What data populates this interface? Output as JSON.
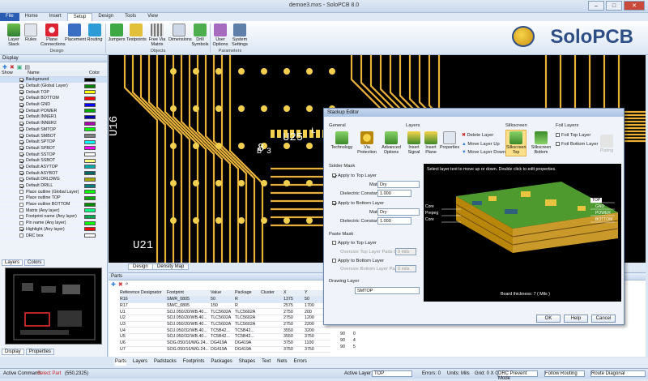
{
  "window": {
    "title": "demoe3.mxs - SoloPCB 8.0"
  },
  "tabs": [
    "File",
    "Home",
    "Insert",
    "Setup",
    "Design",
    "Tools",
    "View"
  ],
  "ribbon": {
    "buttons": [
      "Layer Stack",
      "Rules",
      "Plane Connections",
      "Placement",
      "Routing",
      "Jumpers",
      "Testpoints",
      "Free Via Matrix",
      "Dimensions",
      "Drill Symbols",
      "User Options",
      "System Settings"
    ],
    "groups": [
      "Design",
      "Objects",
      "Parameters"
    ]
  },
  "logo": "SoloPCB",
  "display_panel": {
    "title": "Display",
    "columns": [
      "Show",
      "Name",
      "Color"
    ],
    "layers": [
      {
        "name": "Background",
        "on": true,
        "color": "#000000"
      },
      {
        "name": "Default (Global Layer)",
        "on": true,
        "color": "#008000"
      },
      {
        "name": "Default TOP",
        "on": true,
        "color": "#ffff00"
      },
      {
        "name": "Default BOTTOM",
        "on": true,
        "color": "#ff0000"
      },
      {
        "name": "Default GND",
        "on": true,
        "color": "#0000ff"
      },
      {
        "name": "Default POWER",
        "on": true,
        "color": "#00aa00"
      },
      {
        "name": "Default INNER1",
        "on": true,
        "color": "#0000aa"
      },
      {
        "name": "Default INNER2",
        "on": true,
        "color": "#aa00aa"
      },
      {
        "name": "Default SMTOP",
        "on": true,
        "color": "#00ff00"
      },
      {
        "name": "Default SMBOT",
        "on": true,
        "color": "#808080"
      },
      {
        "name": "Default SPTOP",
        "on": true,
        "color": "#00ffff"
      },
      {
        "name": "Default SPBOT",
        "on": true,
        "color": "#ff00ff"
      },
      {
        "name": "Default SSTOP",
        "on": true,
        "color": "#ffffff"
      },
      {
        "name": "Default SSBOT",
        "on": true,
        "color": "#ffff80"
      },
      {
        "name": "Default ASYTOP",
        "on": true,
        "color": "#00aaaa"
      },
      {
        "name": "Default ASYBOT",
        "on": true,
        "color": "#006666"
      },
      {
        "name": "Default DRLDWG",
        "on": true,
        "color": "#aaaa00"
      },
      {
        "name": "Default DRILL",
        "on": true,
        "color": "#008080"
      },
      {
        "name": "Place outline (Global Layer)",
        "on": false,
        "color": "#00ff00"
      },
      {
        "name": "Place outline TOP",
        "on": false,
        "color": "#00aa00"
      },
      {
        "name": "Place outline BOTTOM",
        "on": false,
        "color": "#008800"
      },
      {
        "name": "Matrix (Any layer)",
        "on": false,
        "color": "#00ff80"
      },
      {
        "name": "Footprint name (Any layer)",
        "on": false,
        "color": "#00aa55"
      },
      {
        "name": "Pin name (Any layer)",
        "on": false,
        "color": "#00ff00"
      },
      {
        "name": "Highlight (Any layer)",
        "on": true,
        "color": "#ff0000"
      },
      {
        "name": "DRC box",
        "on": false,
        "color": "#ffffff"
      }
    ],
    "subtabs": [
      "Layers",
      "Colors"
    ]
  },
  "overview_tabs": [
    "Display",
    "Properties"
  ],
  "canvas": {
    "labels": [
      "U16",
      "U25",
      "U21",
      "8",
      "B",
      "3",
      "L",
      "F"
    ],
    "tabs": [
      "Design",
      "Density Map"
    ]
  },
  "parts": {
    "title": "Parts",
    "columns": [
      "Reference Designator",
      "Footprint",
      "Value",
      "Package",
      "Cluster",
      "X",
      "Y"
    ],
    "rows": [
      [
        "R16",
        "SM/R_0805",
        "50",
        "R",
        "",
        "1375",
        "50"
      ],
      [
        "R17",
        "SM/C_0805",
        "150",
        "R",
        "",
        "2575",
        "1700"
      ],
      [
        "U1",
        "SOJ.050/20/WB.40...",
        "TLC5602A",
        "TLC5602A",
        "",
        "2750",
        "200"
      ],
      [
        "U2",
        "SOJ.050/20/WB.40...",
        "TLC5602A",
        "TLC5602A",
        "",
        "2750",
        "1200"
      ],
      [
        "U3",
        "SOJ.050/20/WB.40...",
        "TLC5602A",
        "TLC5602A",
        "",
        "2750",
        "2200"
      ],
      [
        "U4",
        "SOJ.050/32/WB.40...",
        "TC5B42...",
        "TC5B42...",
        "",
        "3550",
        "3200"
      ],
      [
        "U5",
        "SOJ.050/32/WB.40...",
        "TC5B42...",
        "TC5B42...",
        "",
        "3550",
        "3750"
      ],
      [
        "U6",
        "SOG.050/16/WG.24...",
        "DG419A",
        "DG419A",
        "",
        "3750",
        "1100"
      ],
      [
        "U7",
        "SOG.050/16/WG.24...",
        "DG419A",
        "DG419A",
        "",
        "3750",
        "3750"
      ]
    ],
    "extra_cols": [
      [
        "90",
        "0"
      ],
      [
        "90",
        "4"
      ],
      [
        "90",
        "5"
      ]
    ],
    "tabs": [
      "Parts",
      "Layers",
      "Padstacks",
      "Footprints",
      "Packages",
      "Shapes",
      "Text",
      "Nets",
      "Errors"
    ]
  },
  "status": {
    "command_label": "Active Command:",
    "command": "Select Part",
    "coords": "(550,2325)",
    "active_layer_label": "Active Layer:",
    "active_layer": "TOP",
    "errors": "Errors: 0",
    "units": "Units: Mils",
    "grid": "Grid: 0 X 0",
    "drc": "DRC Prevent Mode",
    "routing": "Follow Routing Mo",
    "route": "Route Diagonal"
  },
  "dialog": {
    "title": "Stackup Editor",
    "sections": {
      "general": "General",
      "layers": "Layers",
      "silkscreen": "Silkscreen",
      "foil": "Foil Layers"
    },
    "buttons": [
      "Technology",
      "Via Protection",
      "Advanced Options",
      "Insert Signal",
      "Insert Plane",
      "Properties",
      "Silkscreen Top",
      "Silkscreen Bottom",
      "Plating"
    ],
    "layer_actions": [
      "Delete Layer",
      "Move Layer Up",
      "Move Layer Down"
    ],
    "foil_options": [
      "Foil Top Layer",
      "Foil Bottom Layer"
    ],
    "solder_mask": {
      "title": "Solder Mask",
      "apply_top": "Apply to Top Layer",
      "apply_bottom": "Apply to Bottom Layer",
      "material_label": "Material:",
      "material_top": "Dry",
      "material_bottom": "Dry",
      "dielectric_label": "Dielectric Constant:",
      "dielectric_top": "1.000",
      "dielectric_bottom": "1.000"
    },
    "paste_mask": {
      "title": "Paste Mask",
      "apply_top": "Apply to Top Layer",
      "apply_bottom": "Apply to Bottom Layer",
      "oversize_top": "Oversize Top Layer Pads by:",
      "oversize_bottom": "Oversize Bottom Layer Pads by:",
      "mils_top": "0 mils",
      "mils_bottom": "0 mils"
    },
    "drawing_layer": {
      "title": "Drawing Layer",
      "value": "SMTOP"
    },
    "preview": {
      "hint": "Select layer text to move up or down. Double click to edit properties.",
      "labels_left": [
        "Core",
        "Prepeg",
        "Core"
      ],
      "labels_right": [
        "TOP",
        "GND",
        "POWER",
        "BOTTOM"
      ],
      "thickness": "Board thickness: 7 ( Mils )"
    },
    "ok": "OK",
    "help": "Help",
    "cancel": "Cancel"
  },
  "colors": {
    "accent": "#2a5cb3",
    "trace": "#e8b13a",
    "pad": "#f2cf4e",
    "board": "#3b7a2a"
  }
}
